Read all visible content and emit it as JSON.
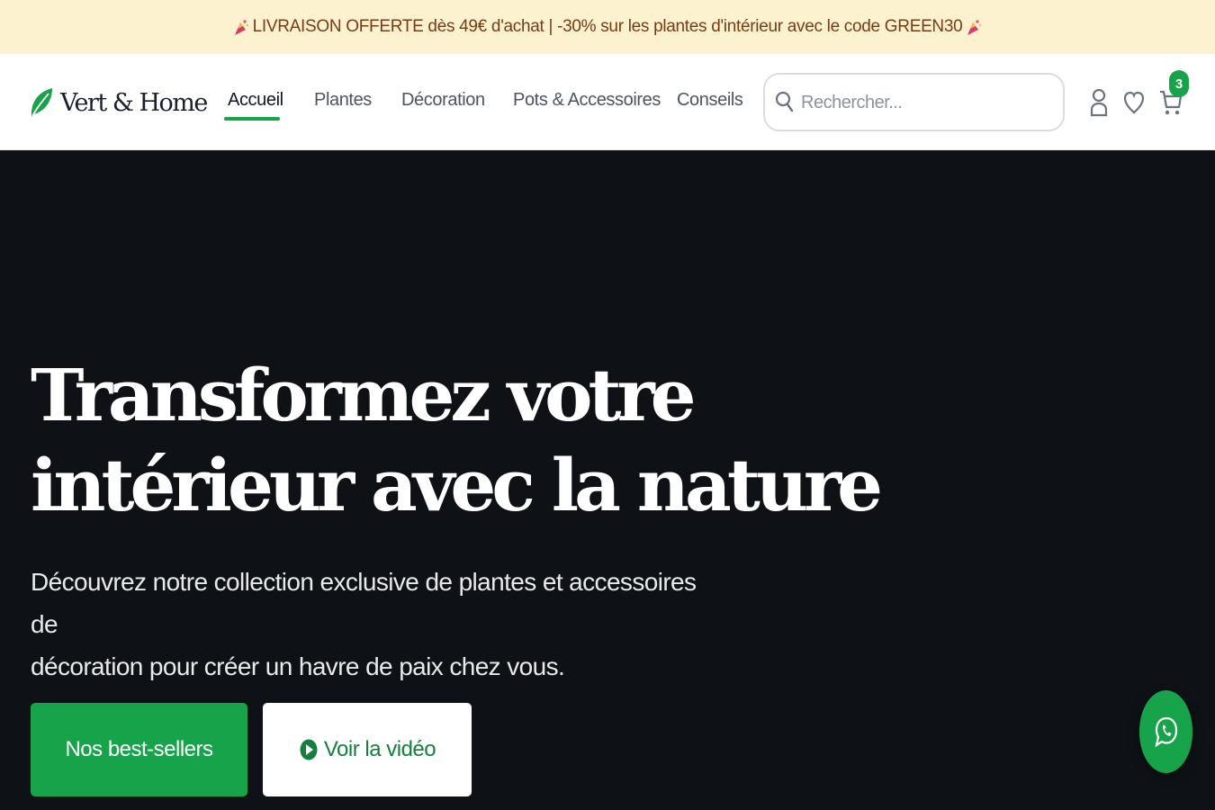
{
  "promo": {
    "text": "LIVRAISON OFFERTE dès 49€ d'achat | -30% sur les plantes d'intérieur avec le code GREEN30"
  },
  "brand": {
    "name": "Vert & Home",
    "accent_color": "#16a34a"
  },
  "nav": {
    "items": [
      {
        "label": "Accueil",
        "active": true
      },
      {
        "label": "Plantes",
        "active": false
      },
      {
        "label": "Décoration",
        "active": false
      },
      {
        "label": "Pots & Accessoires",
        "active": false
      },
      {
        "label": "Conseils",
        "active": false
      }
    ]
  },
  "search": {
    "placeholder": "Rechercher...",
    "icon": "search-icon"
  },
  "header_icons": {
    "account": "user-icon",
    "wishlist": "heart-icon",
    "cart": "cart-icon",
    "cart_count": "3"
  },
  "hero": {
    "title_line1": "Transformez votre",
    "title_line2": "intérieur avec la nature",
    "subtitle_line1": "Découvrez notre collection exclusive de plantes et accessoires de",
    "subtitle_line2": "décoration pour créer un havre de paix chez vous.",
    "primary_cta": "Nos best-sellers",
    "secondary_cta": "Voir la vidéo"
  },
  "floating": {
    "chat_icon": "whatsapp-icon"
  }
}
